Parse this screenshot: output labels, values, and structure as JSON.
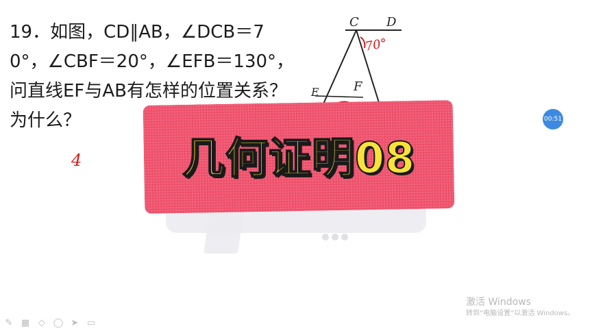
{
  "problem": {
    "lines": [
      "19．如图，CD∥AB，∠DCB＝7",
      "0°，∠CBF＝20°，∠EFB＝130°，",
      "问直线EF与AB有怎样的位置关系？",
      "为什么？"
    ]
  },
  "figure": {
    "label_c": "C",
    "label_d": "D",
    "label_e": "E",
    "label_f": "F",
    "angle_annotation": "70°"
  },
  "red_mark": "4",
  "timer": {
    "label": "00:51"
  },
  "banner": {
    "title": "几何证明08"
  },
  "watermark": {
    "line1": "激活 Windows",
    "line2": "转到“电脑设置”以激活 Windows。"
  },
  "toolbar": {
    "icons": [
      "pen-icon",
      "grid-icon",
      "eraser-icon",
      "lasso-icon",
      "pointer-icon",
      "screen-icon"
    ]
  },
  "colors": {
    "banner": "#ee4f6a",
    "title_fill": "#f7e23a",
    "annotation_red": "#d41a1a",
    "timer_blue": "#3d8ae0"
  }
}
